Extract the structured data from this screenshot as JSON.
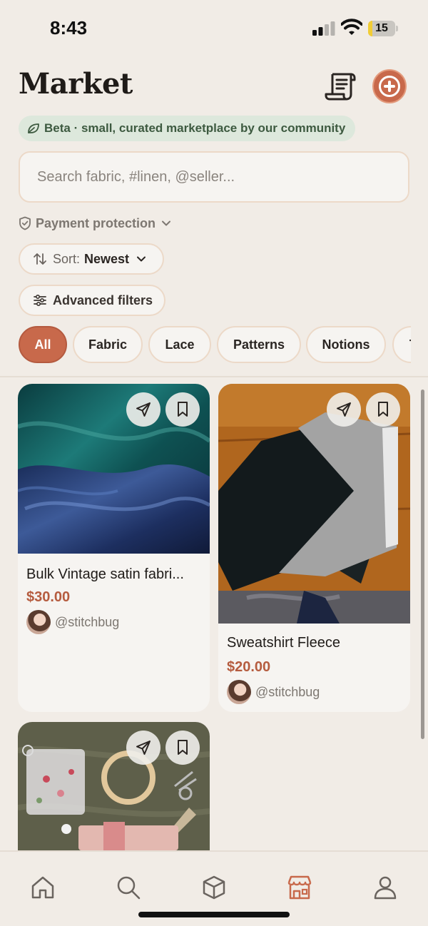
{
  "status_bar": {
    "time": "8:43",
    "battery_level": "15",
    "battery_fraction": 0.15
  },
  "header": {
    "title": "Market",
    "orders_icon": "receipt-icon",
    "add_icon": "plus-circle-icon",
    "accent_color": "#c8694b"
  },
  "beta": {
    "text": "Beta · small, curated marketplace by our community",
    "icon": "leaf-icon"
  },
  "search": {
    "placeholder": "Search fabric, #linen, @seller...",
    "value": ""
  },
  "payment": {
    "label": "Payment protection",
    "icon": "shield-check-icon"
  },
  "sort": {
    "label": "Sort:",
    "value": "Newest",
    "icon": "sort-arrows-icon"
  },
  "filters": {
    "label": "Advanced filters",
    "icon": "sliders-icon"
  },
  "categories": [
    {
      "label": "All",
      "active": true
    },
    {
      "label": "Fabric",
      "active": false
    },
    {
      "label": "Lace",
      "active": false
    },
    {
      "label": "Patterns",
      "active": false
    },
    {
      "label": "Notions",
      "active": false
    },
    {
      "label": "T",
      "active": false
    }
  ],
  "listings": [
    {
      "title": "Bulk Vintage satin fabri...",
      "price": "$30.00",
      "seller": "@stitchbug"
    },
    {
      "title": "Sweatshirt Fleece",
      "price": "$20.00",
      "seller": "@stitchbug"
    },
    {
      "title": "",
      "price": "",
      "seller": ""
    }
  ],
  "nav": [
    {
      "icon": "home-icon",
      "active": false
    },
    {
      "icon": "search-icon",
      "active": false
    },
    {
      "icon": "box-icon",
      "active": false
    },
    {
      "icon": "storefront-icon",
      "active": true
    },
    {
      "icon": "profile-icon",
      "active": false
    }
  ]
}
